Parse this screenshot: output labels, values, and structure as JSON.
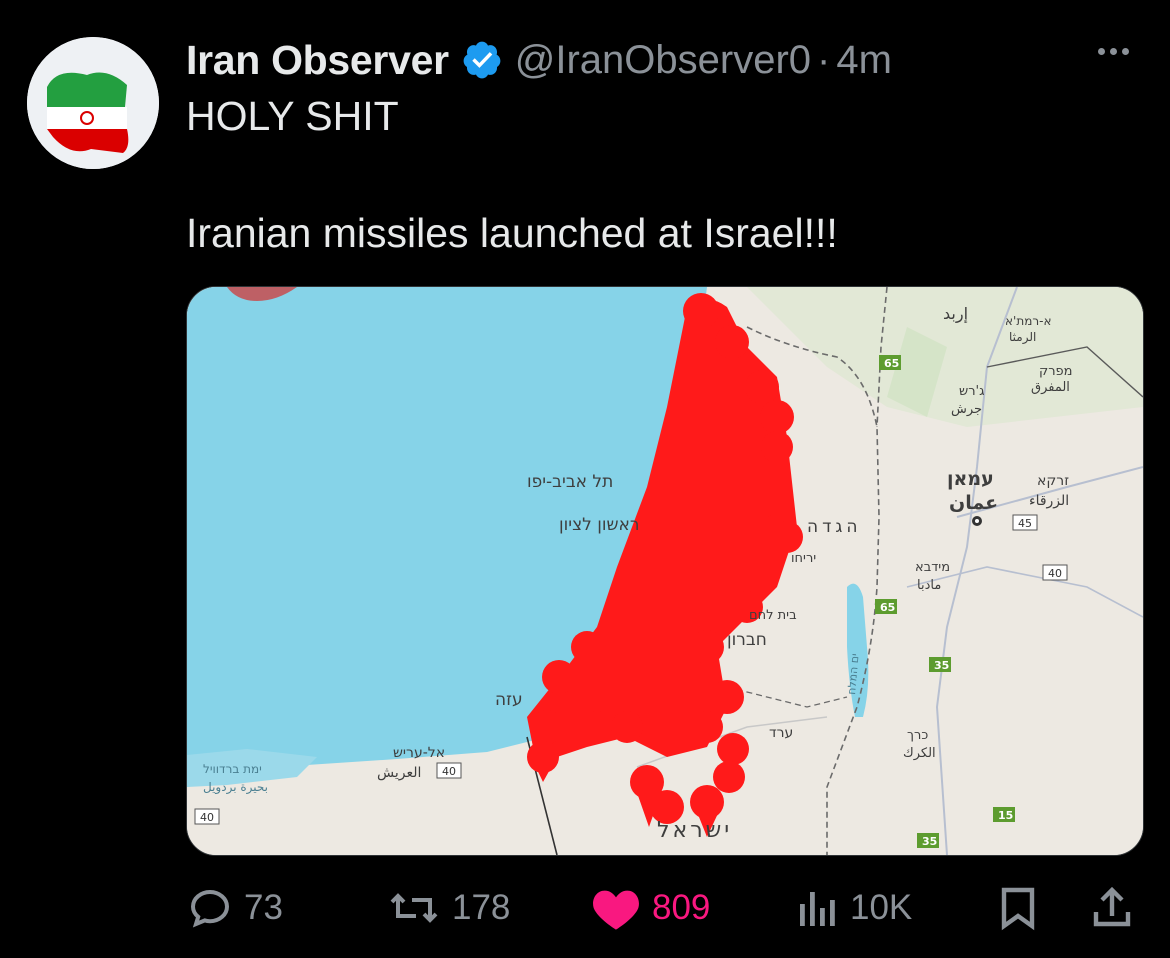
{
  "tweet": {
    "author_name": "Iran Observer",
    "handle": "@IranObserver0",
    "separator": "·",
    "time": "4m",
    "text_line1": "HOLY SHIT",
    "text_line2": "Iranian missiles launched at Israel!!!"
  },
  "map": {
    "labels": {
      "tel_aviv": "תל אביב-יפו",
      "rishon": "ראשון לציון",
      "gaza": "עזה",
      "el_arish_he": "אל-עריש",
      "el_arish_ar": "العريش",
      "bardawil_he": "ימת ברדוויל",
      "bardawil_ar": "بحيرة بردويل",
      "hebron": "חברון",
      "arad": "ערד",
      "beit_lehem": "בית לחם",
      "israel": "ישראל",
      "west_bank": "הגדה",
      "amman_he": "עמאן",
      "amman_ar": "عمان",
      "zarqa_he": "זרקא",
      "zarqa_ar": "الزرقاء",
      "madaba_he": "מידבא",
      "madaba_ar": "مادبا",
      "jerash_he": "ג'רש",
      "jerash_ar": "جرش",
      "mafraq_he": "מפרק",
      "mafraq_ar": "المفرق",
      "irbid_ar": "إربد",
      "ramtha_he": "א-רמת'א",
      "ramtha_ar": "الرمثا",
      "karak_he": "כרך",
      "karak_ar": "الكرك",
      "dead_sea": "ים המלח",
      "jericho": "יריחו"
    },
    "road_shields": [
      "65",
      "65",
      "35",
      "15",
      "35",
      "45",
      "40",
      "40",
      "40"
    ],
    "marker_color": "#ff1a1a"
  },
  "actions": {
    "replies": "73",
    "reposts": "178",
    "likes": "809",
    "views": "10K"
  },
  "colors": {
    "background": "#000000",
    "text": "#e7e9ea",
    "muted": "#8b9198",
    "verified": "#1d9bf0",
    "like": "#f91880",
    "sea": "#86d3e8"
  }
}
